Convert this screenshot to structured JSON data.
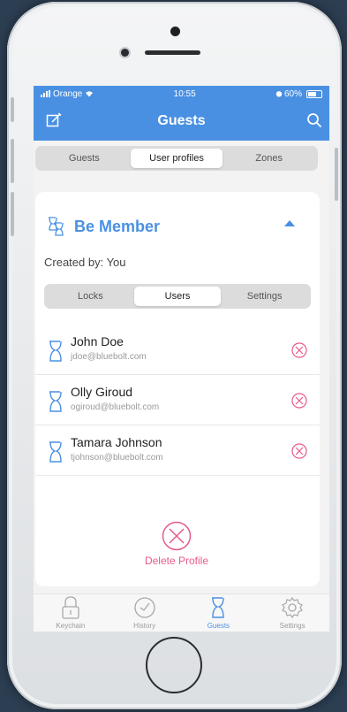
{
  "status": {
    "carrier": "Orange",
    "time": "10:55",
    "battery": "60%"
  },
  "navbar": {
    "title": "Guests"
  },
  "top_tabs": [
    {
      "label": "Guests",
      "active": false
    },
    {
      "label": "User profiles",
      "active": true
    },
    {
      "label": "Zones",
      "active": false
    }
  ],
  "profile": {
    "name": "Be Member",
    "created_by": "Created by: You",
    "tabs": [
      {
        "label": "Locks",
        "active": false
      },
      {
        "label": "Users",
        "active": true
      },
      {
        "label": "Settings",
        "active": false
      }
    ],
    "users": [
      {
        "name": "John Doe",
        "email": "jdoe@bluebolt.com"
      },
      {
        "name": "Olly Giroud",
        "email": "ogiroud@bluebolt.com"
      },
      {
        "name": "Tamara Johnson",
        "email": "tjohnson@bluebolt.com"
      }
    ],
    "delete_label": "Delete Profile"
  },
  "tabbar": [
    {
      "label": "Keychain",
      "icon": "lock-icon",
      "active": false
    },
    {
      "label": "History",
      "icon": "history-icon",
      "active": false
    },
    {
      "label": "Guests",
      "icon": "guests-icon",
      "active": true
    },
    {
      "label": "Settings",
      "icon": "gear-icon",
      "active": false
    }
  ],
  "colors": {
    "accent": "#4a90e2",
    "danger": "#e85a8a"
  }
}
